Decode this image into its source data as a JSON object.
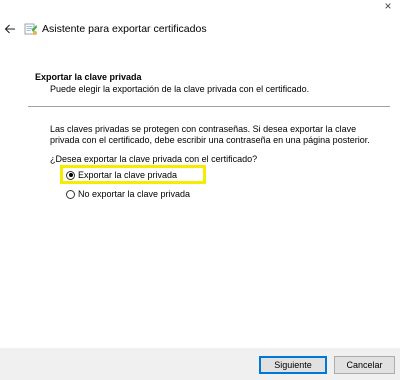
{
  "window": {
    "title": "Asistente para exportar certificados",
    "close_glyph": "×",
    "accent_color": "#0078d7",
    "highlight_color": "#f7ec00"
  },
  "header": {
    "title": "Exportar la clave privada",
    "description": "Puede elegir la exportación de la clave privada con el certificado."
  },
  "body": {
    "paragraph": "Las claves privadas se protegen con contraseñas. Si desea exportar la clave privada con el certificado, debe escribir una contraseña en una página posterior.",
    "question": "¿Desea exportar la clave privada con el certificado?",
    "options": [
      {
        "label": "Exportar la clave privada",
        "selected": true
      },
      {
        "label": "No exportar la clave privada",
        "selected": false
      }
    ]
  },
  "footer": {
    "next_label": "Siguiente",
    "cancel_label": "Cancelar"
  },
  "icons": {
    "back": "back-arrow-icon",
    "wizard": "certificate-wizard-icon",
    "close": "close-icon"
  }
}
